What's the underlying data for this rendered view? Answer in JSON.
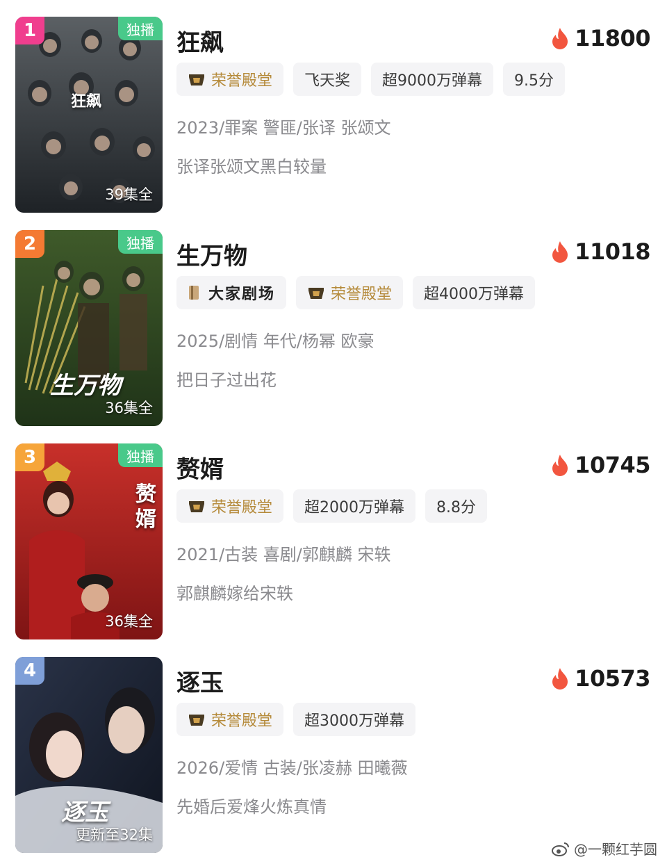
{
  "items": [
    {
      "rank": "1",
      "rank_color": "#f03e8e",
      "title": "狂飙",
      "heat": "11800",
      "exclusive": "独播",
      "episodes": "39集全",
      "poster_title": "狂飙",
      "tags": [
        "荣誉殿堂",
        "飞天奖",
        "超9000万弹幕",
        "9.5分"
      ],
      "meta": "2023/罪案 警匪/张译 张颂文",
      "desc": "张译张颂文黑白较量"
    },
    {
      "rank": "2",
      "rank_color": "#f47a33",
      "title": "生万物",
      "heat": "11018",
      "exclusive": "独播",
      "episodes": "36集全",
      "poster_title": "生万物",
      "tags": [
        "大家剧场",
        "荣誉殿堂",
        "超4000万弹幕"
      ],
      "meta": "2025/剧情 年代/杨幂 欧豪",
      "desc": "把日子过出花"
    },
    {
      "rank": "3",
      "rank_color": "#f6a53a",
      "title": "赘婿",
      "heat": "10745",
      "exclusive": "独播",
      "episodes": "36集全",
      "poster_title": "赘婿",
      "tags": [
        "荣誉殿堂",
        "超2000万弹幕",
        "8.8分"
      ],
      "meta": "2021/古装 喜剧/郭麒麟 宋轶",
      "desc": "郭麒麟嫁给宋轶"
    },
    {
      "rank": "4",
      "rank_color": "#7f9fd8",
      "title": "逐玉",
      "heat": "10573",
      "episodes": "更新至32集",
      "poster_title": "逐玉",
      "tags": [
        "荣誉殿堂",
        "超3000万弹幕"
      ],
      "meta": "2026/爱情 古装/张凌赫 田曦薇",
      "desc": "先婚后爱烽火炼真情"
    }
  ],
  "watermark": "@一颗红芋圆",
  "colors": {
    "flame": "#f2563f",
    "honor_gold": "#b58a3a",
    "exclusive_green": "#49c98a"
  }
}
